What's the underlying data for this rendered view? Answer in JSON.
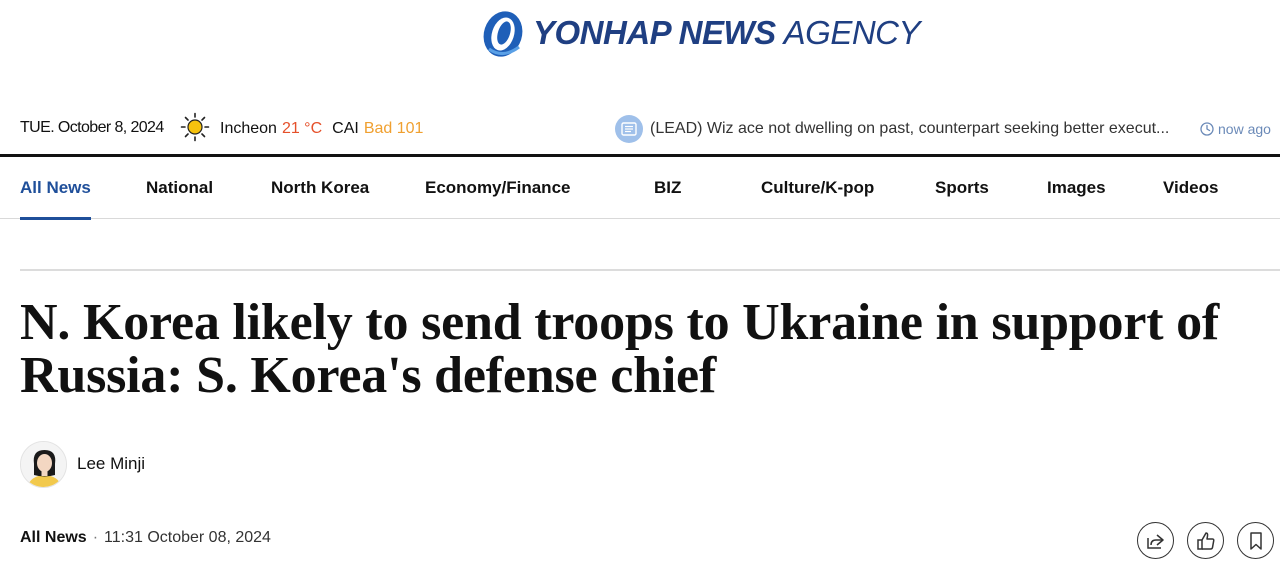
{
  "logo": {
    "bold": "YONHAP NEWS",
    "light": "AGENCY",
    "icon": "yonhap-logo-mark"
  },
  "infobar": {
    "date": "TUE. October 8, 2024",
    "weather": {
      "icon": "sun-icon",
      "city": "Incheon",
      "temp": "21 °C",
      "cai_label": "CAI",
      "cai_status": "Bad 101"
    },
    "ticker": {
      "icon": "news-icon",
      "text": "(LEAD) Wiz ace not dwelling on past, counterpart seeking better execut...",
      "time": "now ago"
    }
  },
  "nav": {
    "items": [
      {
        "label": "All News",
        "active": true
      },
      {
        "label": "National"
      },
      {
        "label": "North Korea"
      },
      {
        "label": "Economy/Finance"
      },
      {
        "label": "BIZ"
      },
      {
        "label": "Culture/K-pop"
      },
      {
        "label": "Sports"
      },
      {
        "label": "Images"
      },
      {
        "label": "Videos"
      }
    ]
  },
  "article": {
    "headline": "N. Korea likely to send troops to Ukraine in support of Russia: S. Korea's defense chief",
    "author": "Lee Minji",
    "category": "All News",
    "separator": "·",
    "timestamp": "11:31 October 08, 2024"
  },
  "actions": {
    "share_icon": "share-icon",
    "like_icon": "thumbs-up-icon",
    "bookmark_icon": "bookmark-icon"
  },
  "colors": {
    "brand": "#1f3f82",
    "active_nav": "#1f4f9a",
    "temp": "#e5502a",
    "cai": "#f0a030"
  }
}
